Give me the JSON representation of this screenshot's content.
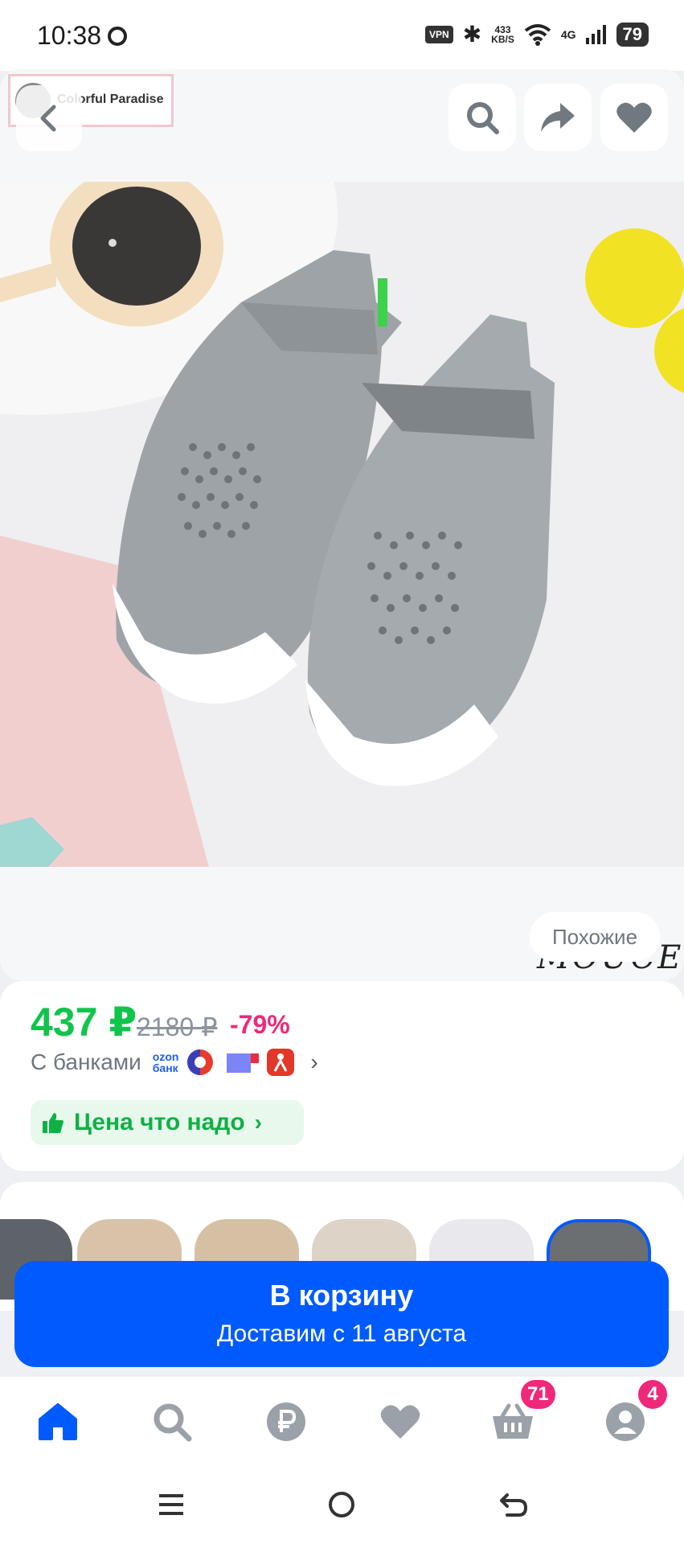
{
  "status_bar": {
    "time": "10:38",
    "vpn": "VPN",
    "speed_value": "433",
    "speed_unit": "KB/S",
    "network": "4G",
    "battery": "79"
  },
  "header": {
    "store_name": "Colorful Paradise"
  },
  "gallery": {
    "similar_label": "Похожие",
    "brand_watermark": "MOUCE"
  },
  "price": {
    "current": "437 ₽",
    "old": "2180 ₽",
    "discount": "-79%",
    "banks_label": "С банками",
    "ozon_bank_top": "ozon",
    "ozon_bank_bottom": "банк",
    "promo_label": "Цена что надо"
  },
  "cart_button": {
    "label": "В корзину",
    "delivery": "Доставим с 11 августа"
  },
  "bottom_nav": {
    "cart_badge": "71",
    "profile_badge": "4"
  },
  "colors": {
    "accent_blue": "#005bff",
    "price_green": "#10c44c",
    "discount_pink": "#f0287a",
    "nav_icon_gray": "#9ba1a8"
  },
  "icons": [
    "back-icon",
    "search-icon",
    "share-icon",
    "heart-icon",
    "thumbs-up-icon",
    "home-icon",
    "ruble-icon",
    "basket-icon",
    "profile-icon"
  ]
}
